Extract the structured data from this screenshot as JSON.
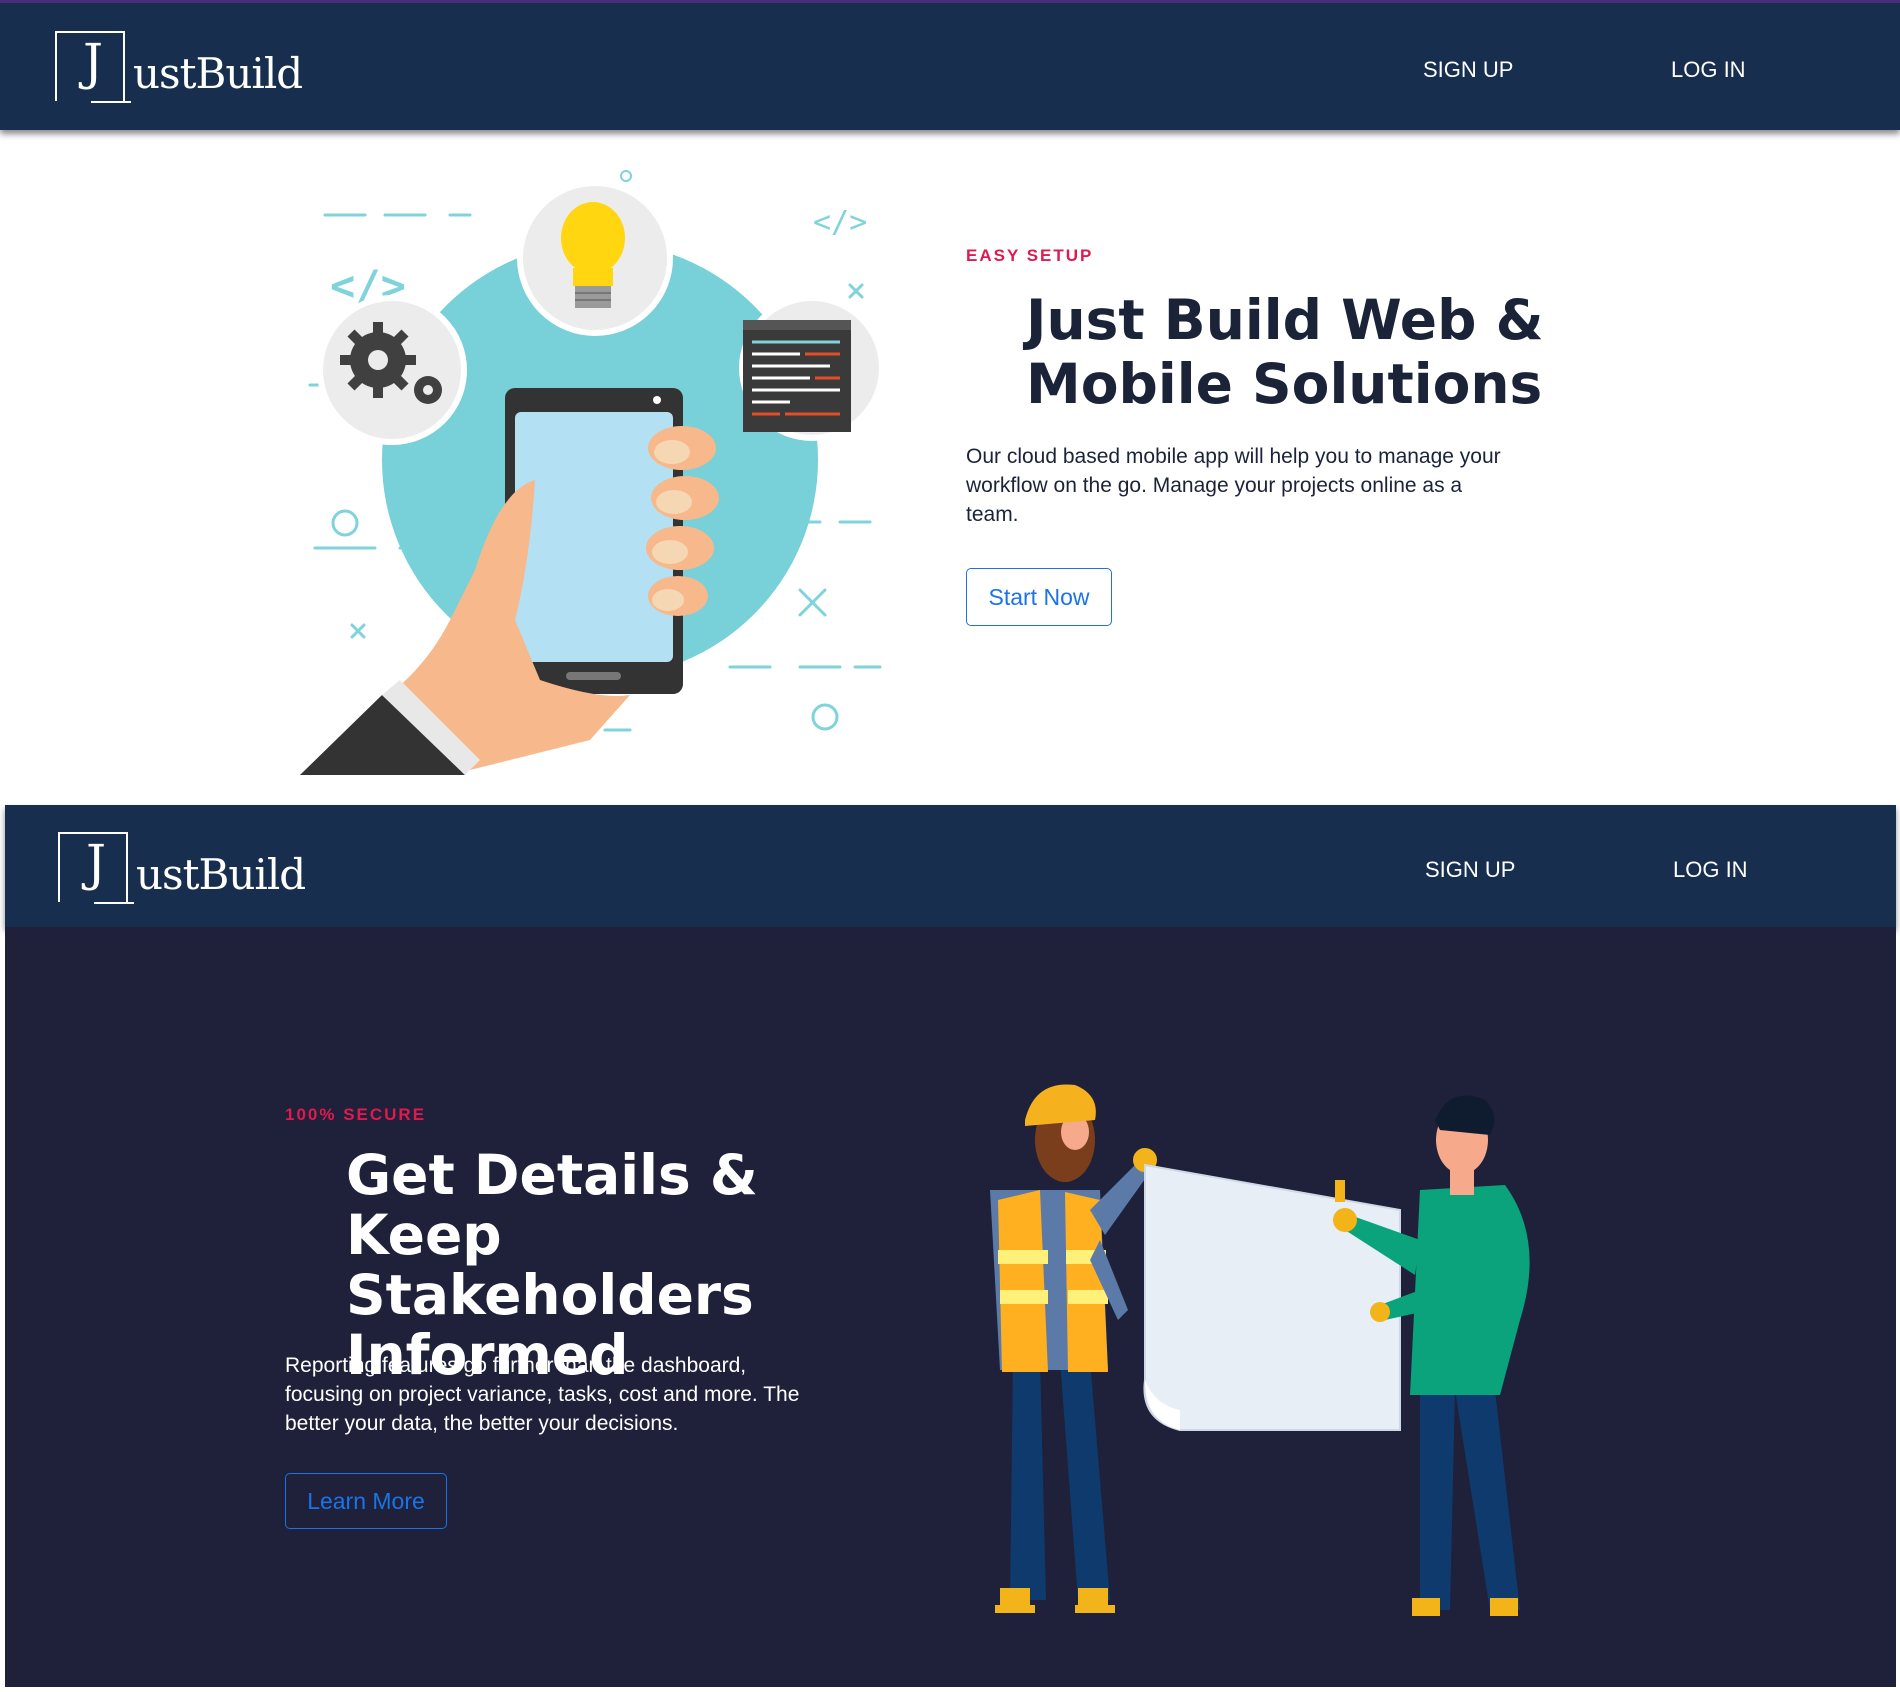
{
  "brand": {
    "logo_text": "ustBuild",
    "logo_initial": "J"
  },
  "nav": {
    "sign_up": "SIGN UP",
    "log_in": "LOG IN"
  },
  "hero": {
    "eyebrow": "EASY SETUP",
    "title": "Just Build Web & Mobile Solutions",
    "description": "Our cloud based mobile app will help you to manage your workflow on the go. Manage your projects online as a team.",
    "button": "Start Now"
  },
  "feature": {
    "eyebrow": "100% SECURE",
    "title": "Get Details & Keep Stakeholders Informed",
    "description": "Reporting features go further than the dashboard, focusing on project variance, tasks, cost and more. The better your data, the better your decisions.",
    "button": "Learn More"
  },
  "colors": {
    "navbar": "#172e4f",
    "dark_section": "#1e2139",
    "accent_red": "#e0194f",
    "button_blue": "#1a73e8"
  }
}
